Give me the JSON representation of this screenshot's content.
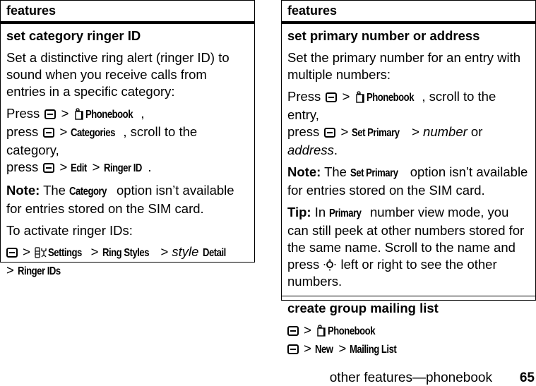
{
  "left_table": {
    "header": "features",
    "section": {
      "title": "set category ringer ID",
      "description": "Set a distinctive ring alert (ringer ID) to sound when you receive calls from entries in a specific category:",
      "steps": {
        "press": "Press",
        "press_lower": "press",
        "sep": ">",
        "phonebook": "Phonebook",
        "categories": "Categories",
        "scroll_text": ", scroll to the category,",
        "edit": "Edit",
        "ringer_id": "Ringer ID",
        "period": "."
      },
      "note": {
        "label": "Note:",
        "pre": "The",
        "cmd": "Category",
        "post": "option isn’t available for entries stored on the SIM card."
      },
      "activate": "To activate ringer IDs:",
      "path": {
        "settings": "Settings",
        "ring_styles": "Ring Styles",
        "style": "style",
        "detail": "Detail",
        "ringer_ids": "Ringer IDs"
      }
    }
  },
  "right_table": {
    "header": "features",
    "section1": {
      "title": "set primary number or address",
      "description": "Set the primary number for an entry with multiple numbers:",
      "steps": {
        "press": "Press",
        "press_lower": "press",
        "phonebook": "Phonebook",
        "scroll_text": ", scroll to the entry,",
        "set_primary": "Set Primary",
        "number": "number",
        "or": "or",
        "address": "address",
        "period": "."
      },
      "note": {
        "label": "Note:",
        "pre": "The",
        "cmd": "Set Primary",
        "post": "option isn’t available for entries stored on the SIM card."
      },
      "tip": {
        "label": "Tip:",
        "pre": "In",
        "cmd": "Primary",
        "post": "number view mode, you can still peek at other numbers stored for the same name. Scroll to the name and press",
        "post2": "left or right to see the other numbers."
      }
    },
    "section2": {
      "title": "create group mailing list",
      "phonebook": "Phonebook",
      "new": "New",
      "mailing_list": "Mailing List"
    }
  },
  "footer": {
    "text": "other features—phonebook",
    "page_number": "65"
  },
  "icons": {
    "menu_key": "menu-key-icon",
    "phonebook": "phonebook-icon",
    "settings": "settings-icon",
    "nav_key": "nav-key-icon"
  }
}
